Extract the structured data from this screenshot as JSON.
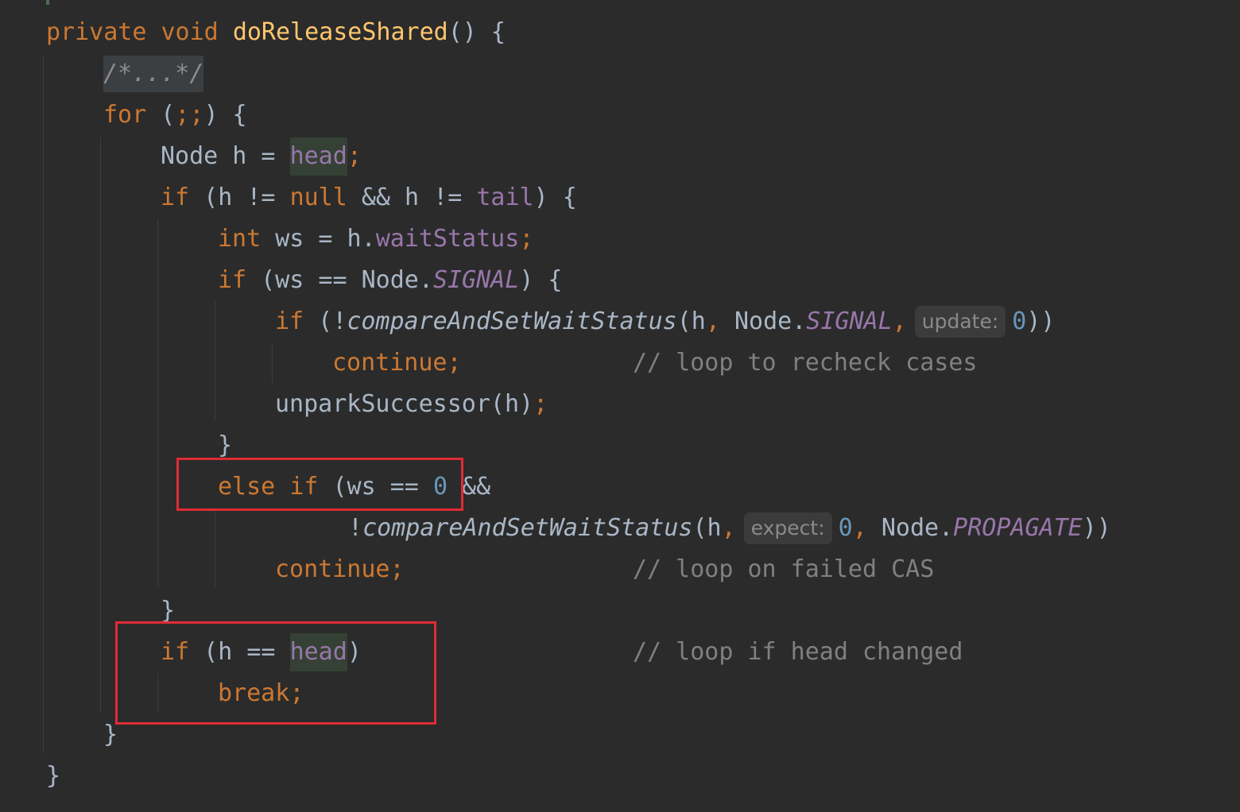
{
  "colors": {
    "background": "#2b2b2b",
    "keyword": "#cc7832",
    "method": "#ffc66d",
    "field": "#9876aa",
    "number": "#6897bb",
    "comment": "#808080",
    "text": "#a9b7c6",
    "highlight_box": "#e02b36"
  },
  "code": {
    "l1": {
      "kw1": "private",
      "kw2": "void",
      "fn": "doReleaseShared",
      "rest": "() {"
    },
    "l2": {
      "fold": "/*...*/"
    },
    "l3": {
      "kw": "for",
      "rest": " (",
      "semi": ";;",
      "close": ") {"
    },
    "l4": {
      "pre": "Node h = ",
      "fld": "head",
      "semi": ";"
    },
    "l5": {
      "kw": "if",
      "p1": " (h != ",
      "null": "null",
      "p2": " && h != ",
      "fld": "tail",
      "p3": ") {"
    },
    "l6": {
      "kw": "int",
      "p1": " ws = h.",
      "fld": "waitStatus",
      "semi": ";"
    },
    "l7": {
      "kw": "if",
      "p1": " (ws == Node.",
      "fld": "SIGNAL",
      "p2": ") {"
    },
    "l8": {
      "kw": "if",
      "p1": " (!",
      "mi": "compareAndSetWaitStatus",
      "p2": "(h",
      "comma1": ",",
      "p3": " Node.",
      "fld": "SIGNAL",
      "comma2": ",",
      "hint": "update:",
      "num": "0",
      "p4": "))"
    },
    "l9": {
      "kw": "continue",
      "semi": ";",
      "cmt": "// loop to recheck cases"
    },
    "l10": {
      "p1": "unparkSuccessor(h)",
      "semi": ";"
    },
    "l11": {
      "p1": "}"
    },
    "l12": {
      "kw1": "else",
      "kw2": "if",
      "p1": " (ws == ",
      "num": "0",
      "p2": " &&"
    },
    "l13": {
      "p1": "!",
      "mi": "compareAndSetWaitStatus",
      "p2": "(h",
      "comma1": ",",
      "hint": "expect:",
      "num": "0",
      "comma2": ",",
      "p3": " Node.",
      "fld": "PROPAGATE",
      "p4": "))"
    },
    "l14": {
      "kw": "continue",
      "semi": ";",
      "cmt": "// loop on failed CAS"
    },
    "l15": {
      "p1": "}"
    },
    "l16": {
      "kw": "if",
      "p1": " (h == ",
      "fld": "head",
      "p2": ")",
      "cmt": "// loop if head changed"
    },
    "l17": {
      "kw": "break",
      "semi": ";"
    },
    "l18": {
      "p1": "}"
    },
    "l19": {
      "p1": "}"
    }
  }
}
